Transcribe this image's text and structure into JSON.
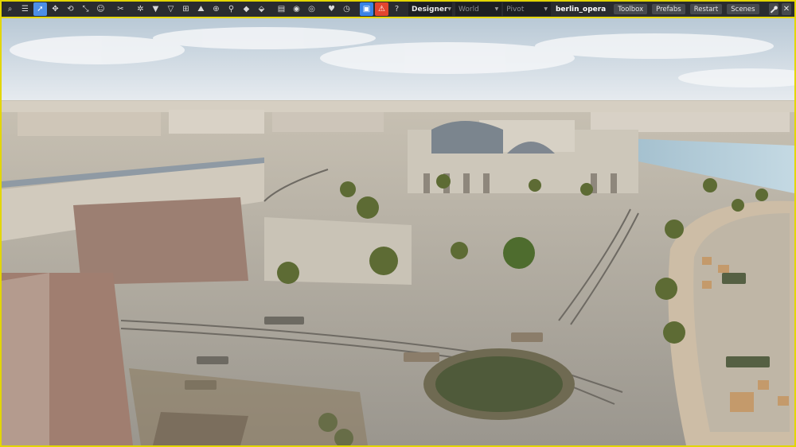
{
  "toolbar": {
    "tools": [
      {
        "icon": "search-icon",
        "glyph": "⌕",
        "active": false
      },
      {
        "icon": "menu-icon",
        "glyph": "☰",
        "active": false
      },
      {
        "icon": "select-cursor-icon",
        "glyph": "➚",
        "active": true
      },
      {
        "icon": "move-icon",
        "glyph": "✥",
        "active": false
      },
      {
        "icon": "rotate-icon",
        "glyph": "⟲",
        "active": false
      },
      {
        "icon": "scale-icon",
        "glyph": "⤡",
        "active": false
      },
      {
        "icon": "smiley-icon",
        "glyph": "☺",
        "active": false
      },
      {
        "icon": "sep",
        "glyph": "",
        "active": false
      },
      {
        "icon": "cut-icon",
        "glyph": "✂",
        "active": false
      },
      {
        "icon": "sep",
        "glyph": "",
        "active": false
      },
      {
        "icon": "snap-icon",
        "glyph": "✲",
        "active": false
      },
      {
        "icon": "drop-down-icon",
        "glyph": "▼",
        "active": false
      },
      {
        "icon": "drop-to-ground-icon",
        "glyph": "▽",
        "active": false
      },
      {
        "icon": "grid-icon",
        "glyph": "⊞",
        "active": false
      },
      {
        "icon": "terrain-icon",
        "glyph": "⛰",
        "active": false
      },
      {
        "icon": "target-icon",
        "glyph": "⊕",
        "active": false
      },
      {
        "icon": "pin-icon",
        "glyph": "⚲",
        "active": false
      },
      {
        "icon": "diamond-icon",
        "glyph": "◆",
        "active": false
      },
      {
        "icon": "waypoint-icon",
        "glyph": "⬙",
        "active": false
      },
      {
        "icon": "sep",
        "glyph": "",
        "active": false
      },
      {
        "icon": "document-icon",
        "glyph": "▤",
        "active": false
      },
      {
        "icon": "eye-icon",
        "glyph": "◉",
        "active": false
      },
      {
        "icon": "visibility-icon",
        "glyph": "◎",
        "active": false
      },
      {
        "icon": "sep",
        "glyph": "",
        "active": false
      },
      {
        "icon": "heart-icon",
        "glyph": "♥",
        "active": false
      },
      {
        "icon": "timer-icon",
        "glyph": "◷",
        "active": false
      },
      {
        "icon": "sep",
        "glyph": "",
        "active": false
      },
      {
        "icon": "save-icon",
        "glyph": "▣",
        "active": false,
        "style": "save"
      },
      {
        "icon": "warning-icon",
        "glyph": "⚠",
        "active": false,
        "style": "warn"
      },
      {
        "icon": "help-icon",
        "glyph": "?",
        "active": false
      }
    ],
    "mode_select": "Designer",
    "space_select": "World",
    "pivot_select": "Pivot",
    "scene_name": "berlin_opera",
    "buttons": {
      "toolbox": "Toolbox",
      "prefabs": "Prefabs",
      "restart": "Restart",
      "scenes": "Scenes"
    },
    "right_icons": [
      "wrench-icon",
      "close-icon"
    ]
  },
  "viewport": {
    "description_icon": "3d-scene-viewport",
    "colors": {
      "frame": "#e3d600",
      "toolbar": "#2a2c2f",
      "active": "#4d8fe6",
      "sky_top": "#b9c9d6",
      "sky_bottom": "#e9edf1",
      "ground": "#b9b5ac",
      "water": "#a7c4d1"
    }
  }
}
